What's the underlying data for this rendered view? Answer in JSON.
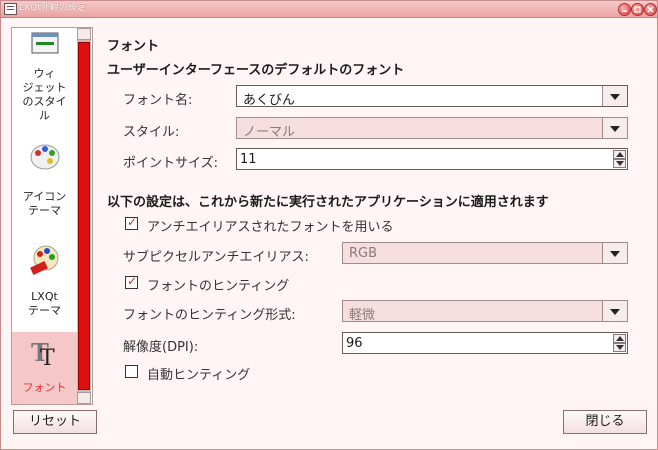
{
  "window": {
    "title": "LXQt外観の設定"
  },
  "sidebar": {
    "items": [
      {
        "label": "ウィジェットのスタイル",
        "lines": [
          "ウィ",
          "ジェット",
          "のスタイ",
          "ル"
        ],
        "icon": "widget-style-icon"
      },
      {
        "label": "アイコンテーマ",
        "lines": [
          "アイコン",
          "テーマ"
        ],
        "icon": "palette-icon"
      },
      {
        "label": "LXQtテーマ",
        "lines": [
          "LXQt",
          "テーマ"
        ],
        "icon": "paint-icon"
      },
      {
        "label": "フォント",
        "lines": [
          "フォント"
        ],
        "icon": "font-icon",
        "selected": true
      }
    ]
  },
  "fonts": {
    "page_title": "フォント",
    "ui_section": "ユーザーインターフェースのデフォルトのフォント",
    "font_name_label": "フォント名:",
    "font_name_value": "あくびん",
    "style_label": "スタイル:",
    "style_value": "ノーマル",
    "point_size_label": "ポイントサイズ:",
    "point_size_value": "11",
    "apps_section": "以下の設定は、これから新たに実行されたアプリケーションに適用されます",
    "antialias_label": "アンチエイリアスされたフォントを用いる",
    "antialias_checked": true,
    "subpixel_label": "サブピクセルアンチエイリアス:",
    "subpixel_value": "RGB",
    "hinting_label": "フォントのヒンティング",
    "hinting_checked": true,
    "hint_style_label": "フォントのヒンティング形式:",
    "hint_style_value": "軽微",
    "dpi_label": "解像度(DPI):",
    "dpi_value": "96",
    "autohint_label": "自動ヒンティング",
    "autohint_checked": false
  },
  "buttons": {
    "reset": "リセット",
    "close": "閉じる"
  },
  "colors": {
    "accent": "#e01010",
    "selected_bg": "#f6c7c7",
    "window_bg": "#fff5f5"
  }
}
